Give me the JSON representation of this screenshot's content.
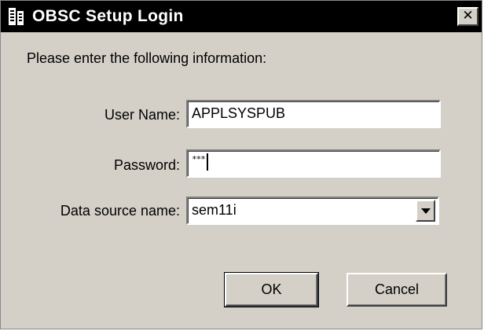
{
  "window": {
    "title": "OBSC Setup Login",
    "icon": "setup-app-icon",
    "close_glyph": "✕"
  },
  "form": {
    "instruction": "Please enter the following information:",
    "user_name": {
      "label": "User Name:",
      "value": "APPLSYSPUB"
    },
    "password": {
      "label": "Password:",
      "value": "***"
    },
    "data_source": {
      "label": "Data source name:",
      "value": "sem11i"
    }
  },
  "buttons": {
    "ok_label": "OK",
    "cancel_label": "Cancel"
  },
  "colors": {
    "title_bar": "#000000",
    "title_text": "#ffffff",
    "dialog_face": "#d4d0c8",
    "field_background": "#ffffff"
  }
}
